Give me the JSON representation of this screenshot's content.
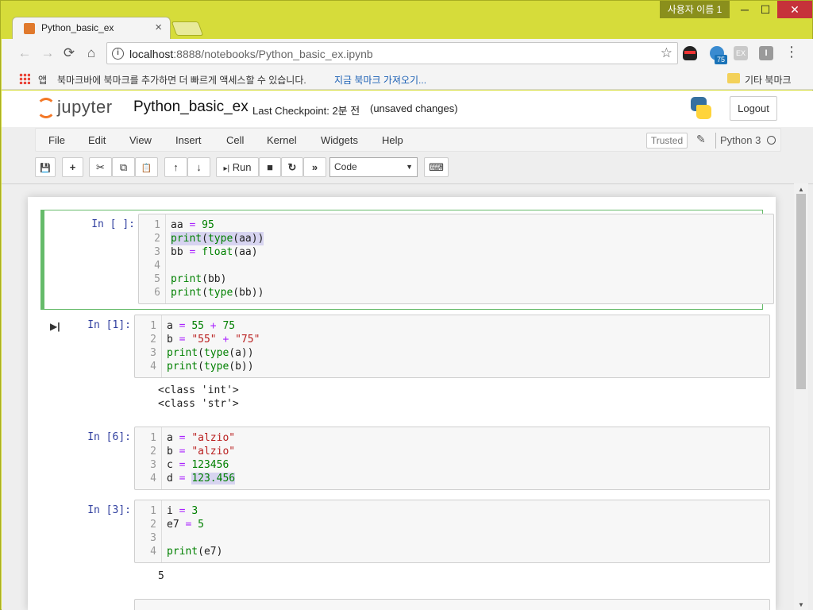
{
  "window": {
    "user_badge": "사용자 이름 1",
    "minimize": "─",
    "maximize": "☐",
    "close": "✕"
  },
  "tab": {
    "title": "Python_basic_ex",
    "close": "×"
  },
  "toolbar": {
    "back": "←",
    "forward": "→",
    "reload": "⟳",
    "home": "⌂",
    "info": "i",
    "url_host": "localhost",
    "url_path": ":8888/notebooks/Python_basic_ex.ipynb",
    "star": "☆",
    "ext_badge": "75",
    "ext_ex": "EX",
    "ext_i": "I",
    "menu": "⋮"
  },
  "bookmarks": {
    "apps": "앱",
    "hint": "북마크바에 북마크를 추가하면 더 빠르게 액세스할 수 있습니다.",
    "import_link": "지금 북마크 가져오기...",
    "other": "기타 북마크"
  },
  "jupyter": {
    "logo": "jupyter",
    "notebook_name": "Python_basic_ex",
    "checkpoint": "Last Checkpoint: 2분 전",
    "unsaved": "(unsaved changes)",
    "logout": "Logout",
    "menu": [
      "File",
      "Edit",
      "View",
      "Insert",
      "Cell",
      "Kernel",
      "Widgets",
      "Help"
    ],
    "trusted": "Trusted",
    "kernel": "Python 3",
    "run_label": "Run",
    "cell_type": "Code",
    "icons": {
      "save": "💾",
      "add": "+",
      "cut": "✂",
      "copy": "⧉",
      "paste": "📋",
      "up": "↑",
      "down": "↓",
      "run": "▸|",
      "stop": "■",
      "restart": "↻",
      "fast_forward": "»",
      "keyboard": "⌨"
    }
  },
  "cells": [
    {
      "prompt": "In [ ]:",
      "selected": true,
      "lines": [
        "aa = 95",
        "print(type(aa))",
        "bb = float(aa)",
        "",
        "print(bb)",
        "print(type(bb))"
      ]
    },
    {
      "prompt": "In [1]:",
      "lines": [
        "a = 55 + 75",
        "b = \"55\" + \"75\"",
        "print(type(a))",
        "print(type(b))"
      ],
      "output": [
        "<class 'int'>",
        "<class 'str'>"
      ]
    },
    {
      "prompt": "In [6]:",
      "lines": [
        "a = \"alzio\"",
        "b = \"alzio\"",
        "c = 123456",
        "d = 123.456"
      ]
    },
    {
      "prompt": "In [3]:",
      "lines": [
        "i = 3",
        "e7 = 5",
        "",
        "print(e7)"
      ],
      "output": [
        "5"
      ]
    }
  ],
  "scrollbar": {
    "up": "▲",
    "down": "▼"
  }
}
